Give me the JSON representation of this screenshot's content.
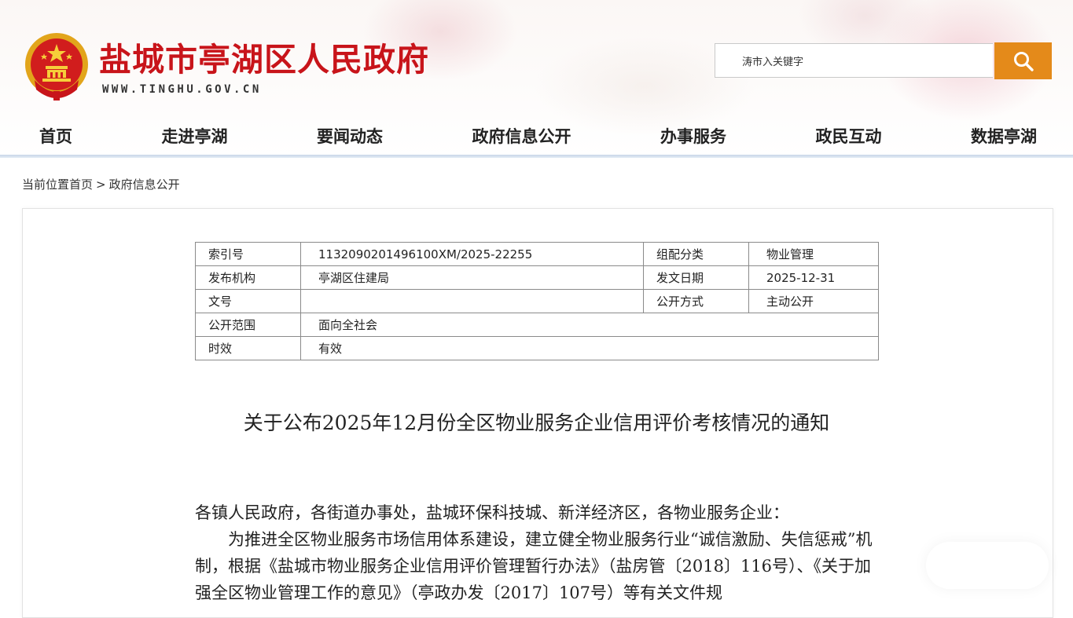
{
  "header": {
    "site_title": "盐城市亭湖区人民政府",
    "site_domain": "WWW.TINGHU.GOV.CN",
    "search": {
      "value": "涛市入关键字",
      "placeholder": ""
    }
  },
  "nav": {
    "items": [
      "首页",
      "走进亭湖",
      "要闻动态",
      "政府信息公开",
      "办事服务",
      "政民互动",
      "数据亭湖"
    ]
  },
  "breadcrumb": {
    "label": "当前位置",
    "home": "首页",
    "separator": ">",
    "current": "政府信息公开"
  },
  "meta": {
    "index_label": "索引号",
    "index_value": "11320902014961​00XM/2025-22255",
    "category_label": "组配分类",
    "category_value": "物业管理",
    "publisher_label": "发布机构",
    "publisher_value": "亭湖区住建局",
    "date_label": "发文日期",
    "date_value": "2025-12-31",
    "docno_label": "文号",
    "docno_value": "",
    "mode_label": "公开方式",
    "mode_value": "主动公开",
    "scope_label": "公开范围",
    "scope_value": "面向全社会",
    "validity_label": "时效",
    "validity_value": "有效"
  },
  "document": {
    "title": "关于公布2025年12月份全区物业服务企业信用评价考核情况的通知",
    "salutation": "各镇人民政府，各街道办事处，盐城环保科技城、新洋经济区，各物业服务企业：",
    "paragraph1": "为推进全区物业服务市场信用体系建设，建立健全物业服务行业“诚信激励、失信惩戒”机制，根据《盐城市物业服务企业信用评价管理暂行办法》（盐房管〔2018〕116号）、《关于加强全区物业管理工作的意见》（亭政办发〔2017〕107号）等有关文件规"
  },
  "colors": {
    "brand_red": "#c8141a",
    "search_button": "#e48a1a"
  },
  "icons": {
    "emblem": "national-emblem-icon",
    "search": "search-icon"
  }
}
